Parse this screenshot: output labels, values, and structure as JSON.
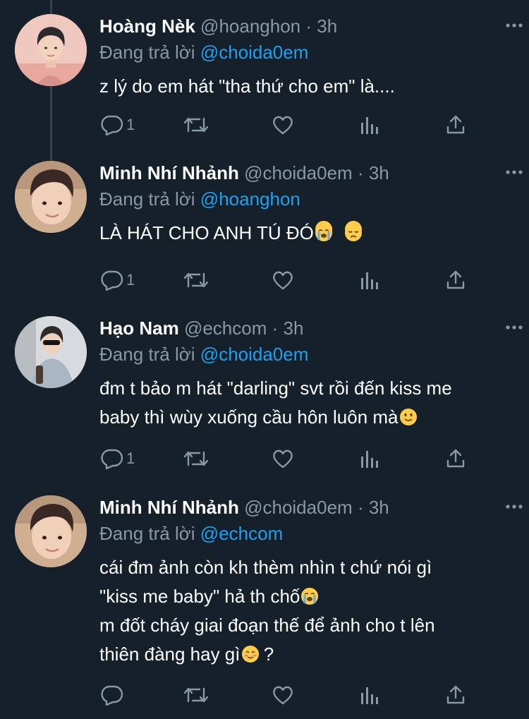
{
  "tweets": [
    {
      "display_name": "Hoàng Nèk",
      "handle": "@hoanghon",
      "time": "3h",
      "reply_prefix": "Đang trả lời",
      "reply_to": "@choida0em",
      "text": "z lý do em hát \"tha thứ cho em\" là....",
      "reply_count": "1",
      "avatar_bg": "#e8bfb5"
    },
    {
      "display_name": "Minh Nhí Nhảnh",
      "handle": "@choida0em",
      "time": "3h",
      "reply_prefix": "Đang trả lời",
      "reply_to": "@hoanghon",
      "text": "LÀ HÁT CHO ANH TÚ ĐÓ",
      "reply_count": "1",
      "avatar_bg": "#d9b7a0"
    },
    {
      "display_name": "Hạo Nam",
      "handle": "@echcom",
      "time": "3h",
      "reply_prefix": "Đang trả lời",
      "reply_to": "@choida0em",
      "text_lines": [
        "đm t bảo m hát \"darling\" svt rồi đến kiss me",
        "baby thì wùy xuống cầu hôn luôn mà"
      ],
      "reply_count": "1",
      "avatar_bg": "#cfd3d8"
    },
    {
      "display_name": "Minh Nhí Nhảnh",
      "handle": "@choida0em",
      "time": "3h",
      "reply_prefix": "Đang trả lời",
      "reply_to": "@echcom",
      "text_lines": [
        "cái đm ảnh còn kh thèm nhìn t chứ nói gì",
        "\"kiss me baby\" hả th chố",
        "m đốt cháy giai đoạn thế để ảnh cho t lên",
        "thiên đàng hay gì",
        " ?"
      ],
      "reply_count": "",
      "avatar_bg": "#d9b7a0"
    }
  ],
  "separator": "·",
  "icons": {
    "more": "more-icon",
    "reply": "reply-icon",
    "retweet": "retweet-icon",
    "like": "heart-icon",
    "analytics": "analytics-icon",
    "share": "share-icon"
  },
  "colors": {
    "background": "#15202b",
    "text": "#ffffff",
    "secondary": "#8899a6",
    "link": "#1da1f2",
    "thread_line": "#38444d"
  }
}
